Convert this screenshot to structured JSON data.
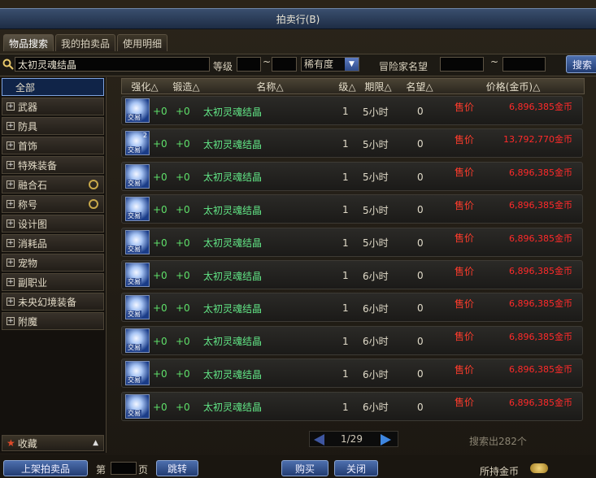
{
  "window": {
    "title": "拍卖行(B)"
  },
  "tabs": [
    {
      "label": "物品搜索"
    },
    {
      "label": "我的拍卖品"
    },
    {
      "label": "使用明细"
    }
  ],
  "search": {
    "value": "太初灵魂结晶",
    "level_label": "等级",
    "tilde": "~",
    "rarity_label": "稀有度",
    "adventurer_label": "冒险家名望",
    "search_button": "搜索"
  },
  "categories": [
    {
      "label": "全部"
    },
    {
      "label": "武器"
    },
    {
      "label": "防具"
    },
    {
      "label": "首饰"
    },
    {
      "label": "特殊装备"
    },
    {
      "label": "融合石"
    },
    {
      "label": "称号"
    },
    {
      "label": "设计图"
    },
    {
      "label": "消耗品"
    },
    {
      "label": "宠物"
    },
    {
      "label": "副职业"
    },
    {
      "label": "未央幻境装备"
    },
    {
      "label": "附魔"
    }
  ],
  "favorites": {
    "label": "收藏"
  },
  "columns": {
    "enhance": "强化△",
    "forge": "锻造△",
    "name": "名称△",
    "level": "级△",
    "duration": "期限△",
    "fame": "名望△",
    "price": "价格(金币)△"
  },
  "rows": [
    {
      "enhance": "+0",
      "forge": "+0",
      "name": "太初灵魂结晶",
      "level": "1",
      "duration": "5小时",
      "fame": "0",
      "sale": "售价",
      "price": "6,896,385金币",
      "qty": "",
      "tag": "交易"
    },
    {
      "enhance": "+0",
      "forge": "+0",
      "name": "太初灵魂结晶",
      "level": "1",
      "duration": "5小时",
      "fame": "0",
      "sale": "售价",
      "price": "13,792,770金币",
      "qty": "2",
      "tag": "交易"
    },
    {
      "enhance": "+0",
      "forge": "+0",
      "name": "太初灵魂结晶",
      "level": "1",
      "duration": "5小时",
      "fame": "0",
      "sale": "售价",
      "price": "6,896,385金币",
      "qty": "",
      "tag": "交易"
    },
    {
      "enhance": "+0",
      "forge": "+0",
      "name": "太初灵魂结晶",
      "level": "1",
      "duration": "5小时",
      "fame": "0",
      "sale": "售价",
      "price": "6,896,385金币",
      "qty": "",
      "tag": "交易"
    },
    {
      "enhance": "+0",
      "forge": "+0",
      "name": "太初灵魂结晶",
      "level": "1",
      "duration": "5小时",
      "fame": "0",
      "sale": "售价",
      "price": "6,896,385金币",
      "qty": "",
      "tag": "交易"
    },
    {
      "enhance": "+0",
      "forge": "+0",
      "name": "太初灵魂结晶",
      "level": "1",
      "duration": "6小时",
      "fame": "0",
      "sale": "售价",
      "price": "6,896,385金币",
      "qty": "",
      "tag": "交易"
    },
    {
      "enhance": "+0",
      "forge": "+0",
      "name": "太初灵魂结晶",
      "level": "1",
      "duration": "6小时",
      "fame": "0",
      "sale": "售价",
      "price": "6,896,385金币",
      "qty": "",
      "tag": "交易"
    },
    {
      "enhance": "+0",
      "forge": "+0",
      "name": "太初灵魂结晶",
      "level": "1",
      "duration": "6小时",
      "fame": "0",
      "sale": "售价",
      "price": "6,896,385金币",
      "qty": "",
      "tag": "交易"
    },
    {
      "enhance": "+0",
      "forge": "+0",
      "name": "太初灵魂结晶",
      "level": "1",
      "duration": "6小时",
      "fame": "0",
      "sale": "售价",
      "price": "6,896,385金币",
      "qty": "",
      "tag": "交易"
    },
    {
      "enhance": "+0",
      "forge": "+0",
      "name": "太初灵魂结晶",
      "level": "1",
      "duration": "6小时",
      "fame": "0",
      "sale": "售价",
      "price": "6,896,385金币",
      "qty": "",
      "tag": "交易"
    }
  ],
  "pager": {
    "text": "1/29"
  },
  "found": "搜索出282个",
  "bottom": {
    "list_button": "上架拍卖品",
    "page_prefix": "第",
    "page_suffix": "页",
    "jump_button": "跳转",
    "buy_button": "购买",
    "close_button": "关闭",
    "gold_label": "所持金币"
  }
}
